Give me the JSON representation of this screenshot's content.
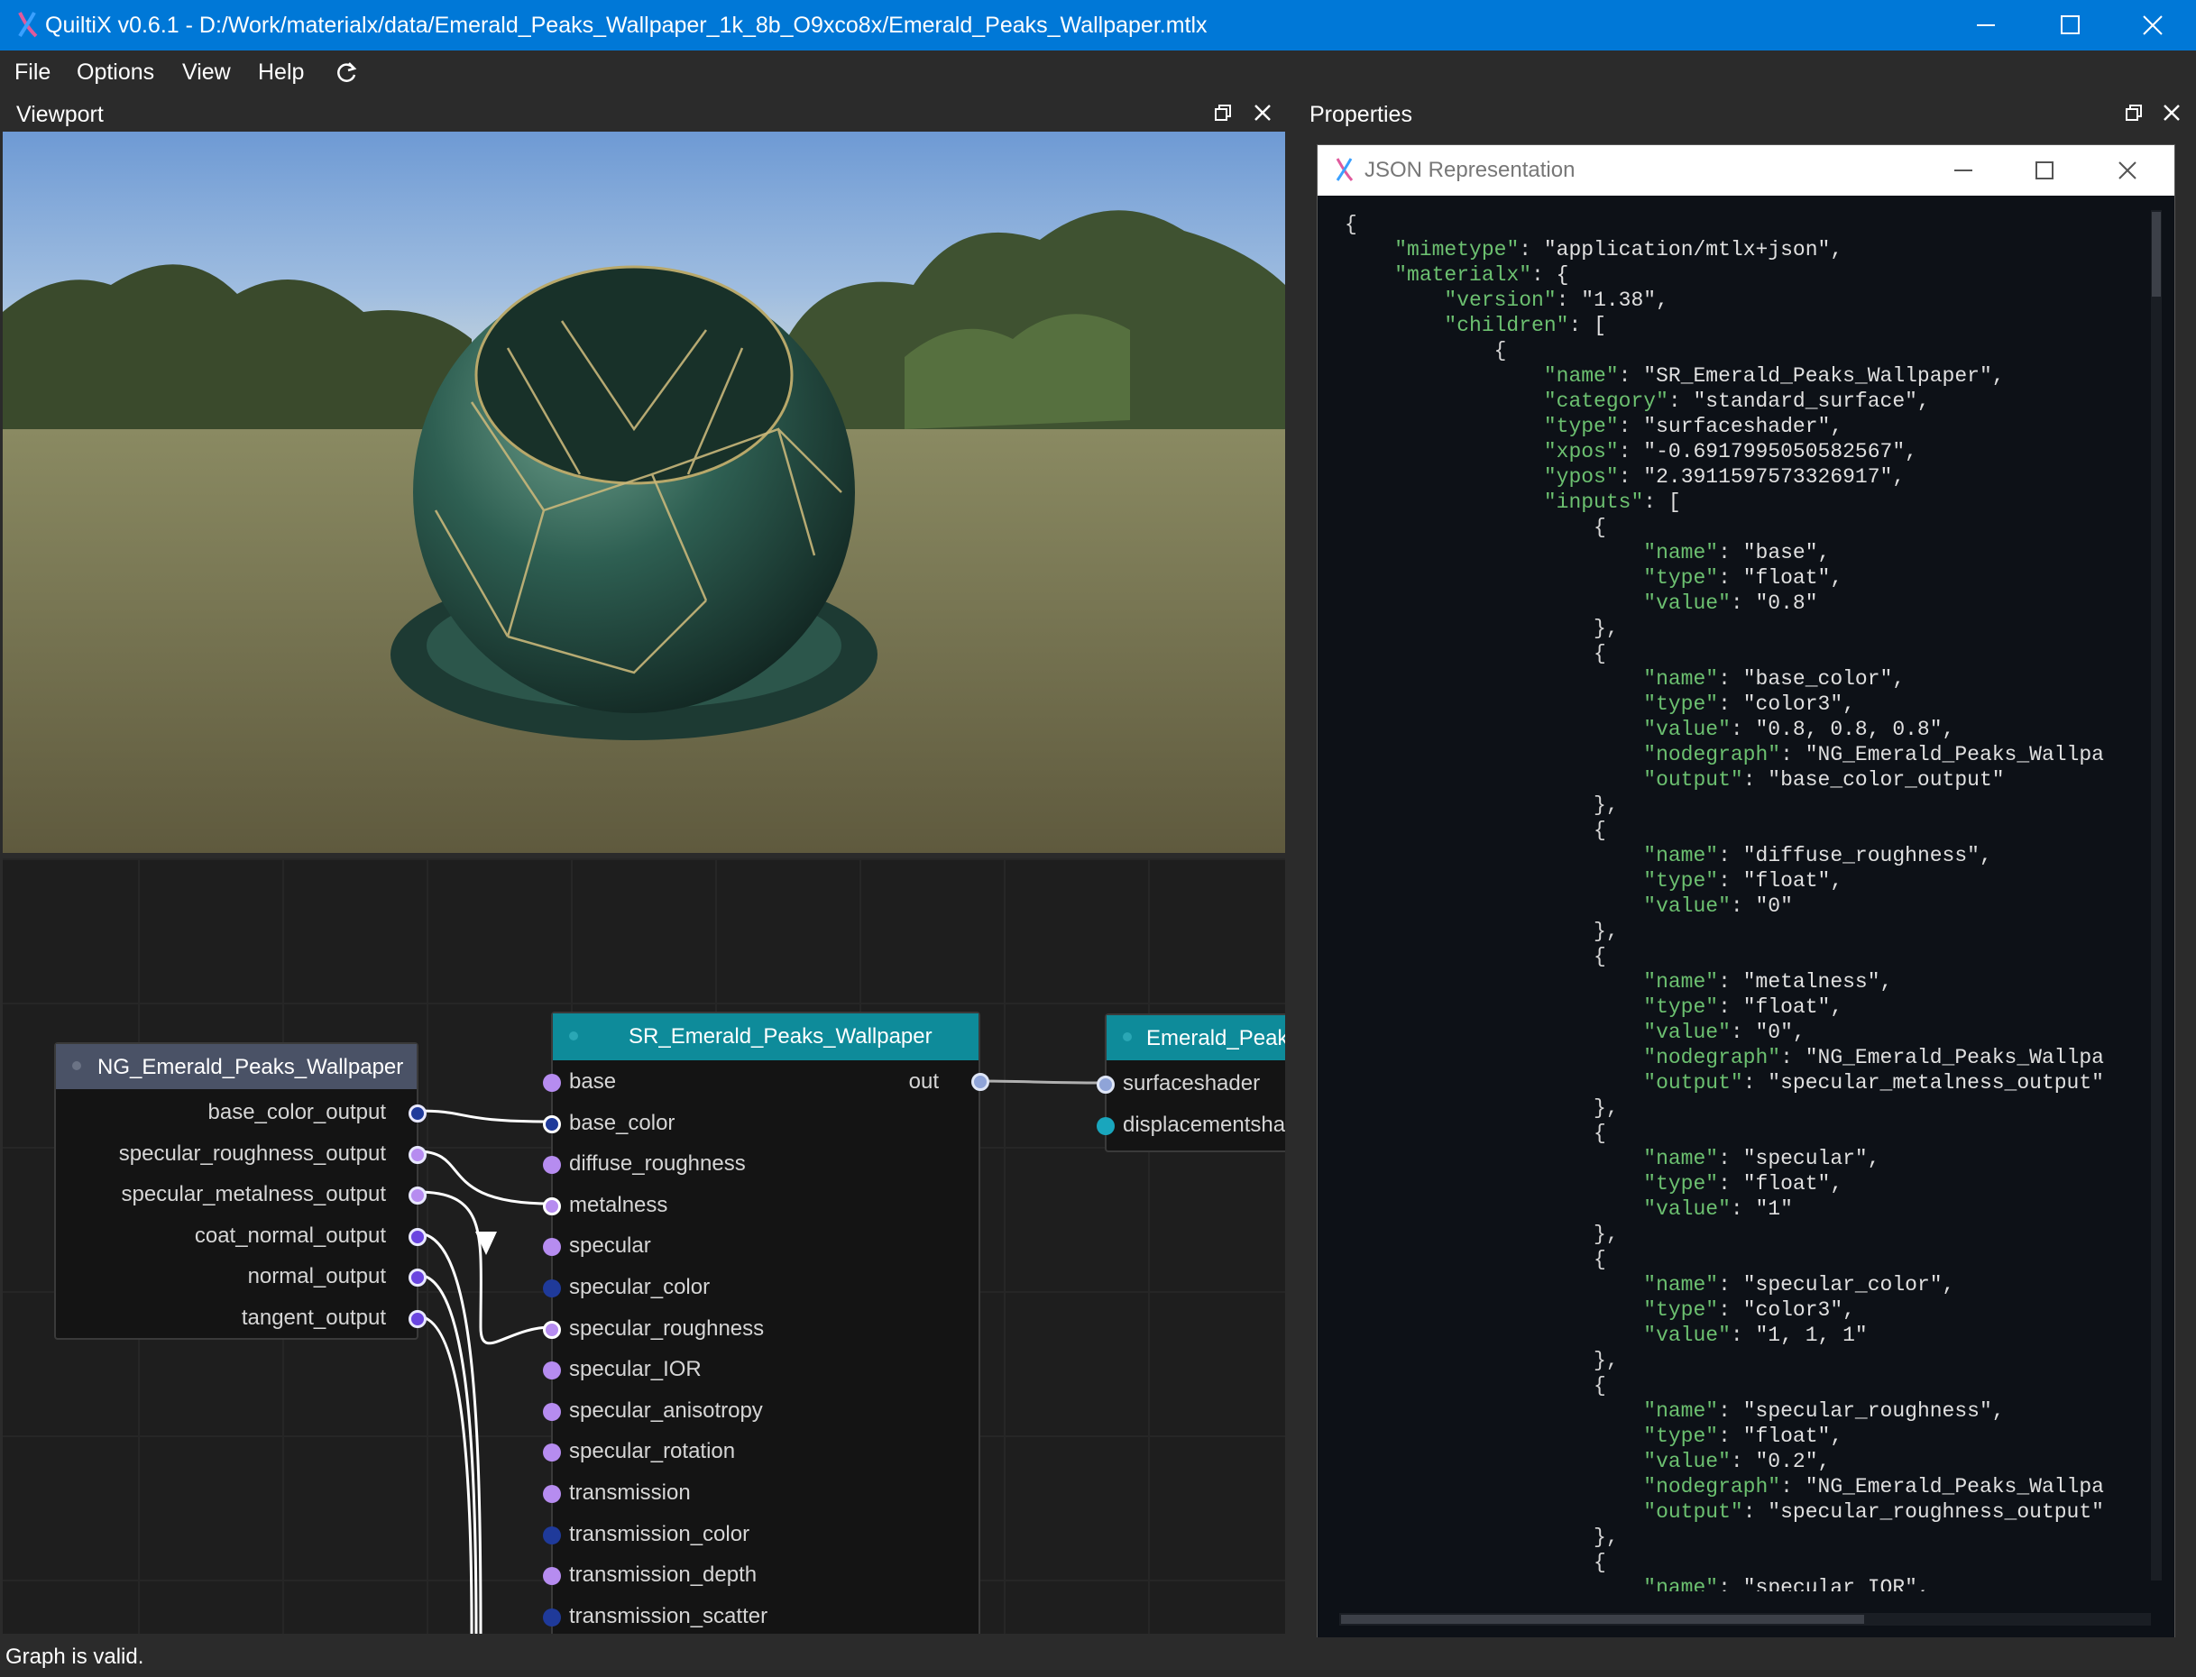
{
  "window": {
    "title": "QuiltiX v0.6.1 - D:/Work/materialx/data/Emerald_Peaks_Wallpaper_1k_8b_O9xco8x/Emerald_Peaks_Wallpaper.mtlx"
  },
  "menu": {
    "items": [
      "File",
      "Options",
      "View",
      "Help"
    ]
  },
  "viewport": {
    "title": "Viewport"
  },
  "graph": {
    "nodegraph": {
      "name": "NG_Emerald_Peaks_Wallpaper",
      "outputs": [
        "base_color_output",
        "specular_roughness_output",
        "specular_metalness_output",
        "coat_normal_output",
        "normal_output",
        "tangent_output"
      ]
    },
    "shader": {
      "name": "SR_Emerald_Peaks_Wallpaper",
      "output": "out",
      "inputs": [
        "base",
        "base_color",
        "diffuse_roughness",
        "metalness",
        "specular",
        "specular_color",
        "specular_roughness",
        "specular_IOR",
        "specular_anisotropy",
        "specular_rotation",
        "transmission",
        "transmission_color",
        "transmission_depth",
        "transmission_scatter"
      ]
    },
    "material": {
      "name": "Emerald_Peaks_",
      "inputs": [
        "surfaceshader",
        "displacementshac"
      ]
    }
  },
  "properties": {
    "title": "Properties"
  },
  "json_window": {
    "title": "JSON Representation",
    "lines": [
      "{",
      "    \"mimetype\": \"application/mtlx+json\",",
      "    \"materialx\": {",
      "        \"version\": \"1.38\",",
      "        \"children\": [",
      "            {",
      "                \"name\": \"SR_Emerald_Peaks_Wallpaper\",",
      "                \"category\": \"standard_surface\",",
      "                \"type\": \"surfaceshader\",",
      "                \"xpos\": \"-0.6917995050582567\",",
      "                \"ypos\": \"2.3911597573326917\",",
      "                \"inputs\": [",
      "                    {",
      "                        \"name\": \"base\",",
      "                        \"type\": \"float\",",
      "                        \"value\": \"0.8\"",
      "                    },",
      "                    {",
      "                        \"name\": \"base_color\",",
      "                        \"type\": \"color3\",",
      "                        \"value\": \"0.8, 0.8, 0.8\",",
      "                        \"nodegraph\": \"NG_Emerald_Peaks_Wallpa",
      "                        \"output\": \"base_color_output\"",
      "                    },",
      "                    {",
      "                        \"name\": \"diffuse_roughness\",",
      "                        \"type\": \"float\",",
      "                        \"value\": \"0\"",
      "                    },",
      "                    {",
      "                        \"name\": \"metalness\",",
      "                        \"type\": \"float\",",
      "                        \"value\": \"0\",",
      "                        \"nodegraph\": \"NG_Emerald_Peaks_Wallpa",
      "                        \"output\": \"specular_metalness_output\"",
      "                    },",
      "                    {",
      "                        \"name\": \"specular\",",
      "                        \"type\": \"float\",",
      "                        \"value\": \"1\"",
      "                    },",
      "                    {",
      "                        \"name\": \"specular_color\",",
      "                        \"type\": \"color3\",",
      "                        \"value\": \"1, 1, 1\"",
      "                    },",
      "                    {",
      "                        \"name\": \"specular_roughness\",",
      "                        \"type\": \"float\",",
      "                        \"value\": \"0.2\",",
      "                        \"nodegraph\": \"NG_Emerald_Peaks_Wallpa",
      "                        \"output\": \"specular_roughness_output\"",
      "                    },",
      "                    {",
      "                        \"name\": \"specular_IOR\","
    ]
  },
  "status": {
    "text": "Graph is valid."
  },
  "colors": {
    "titlebar": "#0078d7",
    "node_header_shader": "#0e8b9a",
    "node_header_graph": "#4a5266",
    "port_float": "#b68cf0",
    "port_color": "#1f3a9a",
    "json_key": "#6cc070"
  }
}
